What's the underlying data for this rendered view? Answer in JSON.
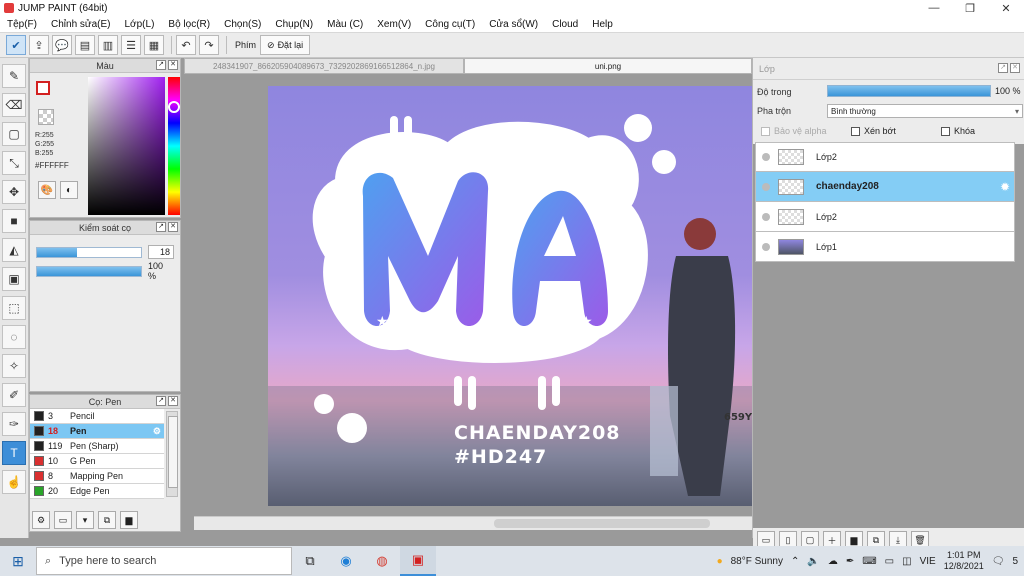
{
  "window": {
    "title": "JUMP PAINT (64bit)"
  },
  "menu": [
    "Tệp(F)",
    "Chỉnh sửa(E)",
    "Lớp(L)",
    "Bộ lọc(R)",
    "Chọn(S)",
    "Chụp(N)",
    "Màu (C)",
    "Xem(V)",
    "Công cụ(T)",
    "Cửa sổ(W)",
    "Cloud",
    "Help"
  ],
  "toolbar": {
    "shortcut_label": "Phím",
    "reset_label": "Đặt lại"
  },
  "color_panel": {
    "title": "Màu",
    "r": "R:255",
    "g": "G:255",
    "b": "B:255",
    "hex": "#FFFFFF"
  },
  "brush_control": {
    "title": "Kiểm soát cọ",
    "size": "18",
    "opacity": "100 %"
  },
  "brush_list": {
    "title": "Cọ: Pen",
    "items": [
      {
        "size": "3",
        "name": "Pencil",
        "color": "#222222"
      },
      {
        "size": "18",
        "name": "Pen",
        "color": "#222222",
        "selected": true
      },
      {
        "size": "119",
        "name": "Pen (Sharp)",
        "color": "#222222"
      },
      {
        "size": "10",
        "name": "G Pen",
        "color": "#d93030"
      },
      {
        "size": "8",
        "name": "Mapping Pen",
        "color": "#d93030"
      },
      {
        "size": "20",
        "name": "Edge Pen",
        "color": "#2aa52a"
      }
    ]
  },
  "tabs": [
    {
      "label": "248341907_866205904089673_7329202869166512864_n.jpg",
      "active": false
    },
    {
      "label": "uni.png",
      "active": true
    }
  ],
  "artwork": {
    "line1": "CHAENDAY208",
    "line2": "#HD247",
    "plate": "659Y"
  },
  "layers_panel": {
    "title": "Lớp",
    "opacity_label": "Độ trong",
    "opacity_value": "100 %",
    "blend_label": "Pha trộn",
    "blend_value": "Bình thường",
    "protect_alpha": "Bảo vệ alpha",
    "clipping": "Xén bớt",
    "lock": "Khóa",
    "layers": [
      {
        "name": "Lớp2",
        "thumb": "check"
      },
      {
        "name": "chaenday208",
        "thumb": "check",
        "selected": true
      },
      {
        "name": "Lớp2",
        "thumb": "check"
      },
      {
        "name": "Lớp1",
        "thumb": "img"
      }
    ]
  },
  "taskbar": {
    "search_placeholder": "Type here to search",
    "weather": "88°F  Sunny",
    "lang": "VIE",
    "time": "1:01 PM",
    "date": "12/8/2021",
    "notifications": "5"
  }
}
